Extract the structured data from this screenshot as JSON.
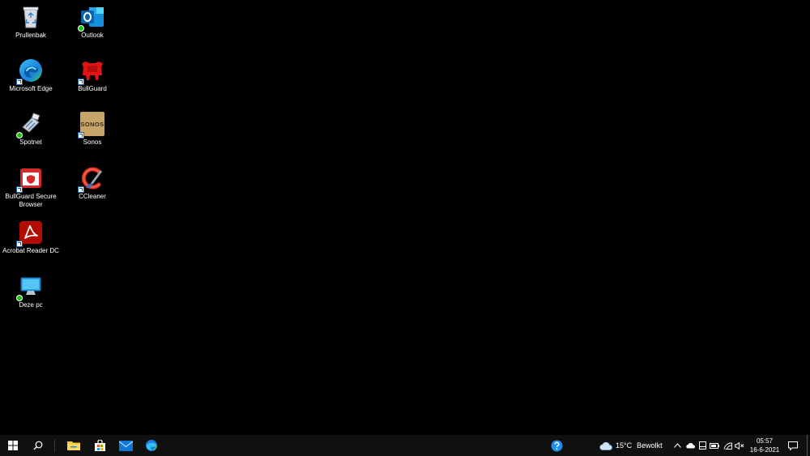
{
  "desktop": {
    "icons": [
      {
        "label": "Prullenbak",
        "icon": "recycle-bin-icon"
      },
      {
        "label": "Microsoft Edge",
        "icon": "edge-icon"
      },
      {
        "label": "Spotnet",
        "icon": "spotnet-icon"
      },
      {
        "label": "BullGuard Secure Browser",
        "icon": "bullguard-browser-icon"
      },
      {
        "label": "Acrobat Reader DC",
        "icon": "acrobat-icon"
      },
      {
        "label": "Deze pc",
        "icon": "this-pc-icon"
      },
      {
        "label": "Outlook",
        "icon": "outlook-icon"
      },
      {
        "label": "BullGuard",
        "icon": "bullguard-icon"
      },
      {
        "label": "Sonos",
        "icon": "sonos-icon",
        "logo_text": "SONOS"
      },
      {
        "label": "CCleaner",
        "icon": "ccleaner-icon"
      }
    ]
  },
  "taskbar": {
    "start": "windows-start-icon",
    "search": "search-icon",
    "pinned": [
      "file-explorer-icon",
      "microsoft-store-icon",
      "mail-icon",
      "edge-icon"
    ],
    "help_icon": "help-icon",
    "weather": {
      "temp": "15°C",
      "condition": "Bewolkt",
      "icon": "cloud-icon"
    },
    "tray_icons": [
      "chevron-up-icon",
      "onedrive-icon",
      "touchpad-icon",
      "battery-icon",
      "wifi-icon",
      "volume-muted-icon"
    ],
    "clock": {
      "time": "05:57",
      "date": "16-6-2021"
    },
    "notifications_icon": "notification-icon"
  },
  "colors": {
    "desktop_bg": "#000000",
    "taskbar_bg": "#101010",
    "accent_blue": "#0078d4"
  }
}
